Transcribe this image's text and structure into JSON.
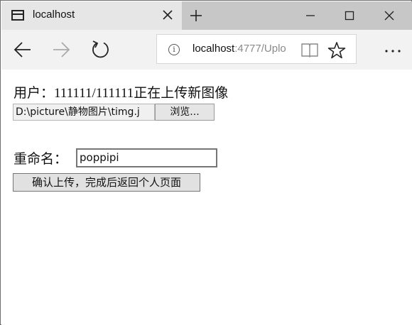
{
  "browser": {
    "tab_title": "localhost",
    "url_host": "localhost",
    "url_rest": ":4777/Uplo"
  },
  "page": {
    "heading_prefix": "用户：",
    "heading_user": "111111/111111",
    "heading_suffix": "正在上传新图像",
    "file_path": "D:\\picture\\静物图片\\timg.j",
    "browse_label": "浏览...",
    "rename_label": "重命名：",
    "rename_value": "poppipi",
    "submit_label": "确认上传，完成后返回个人页面"
  },
  "icons": [
    "tab-page-icon",
    "close-tab-icon",
    "new-tab-icon",
    "minimize-icon",
    "maximize-icon",
    "close-window-icon",
    "back-icon",
    "forward-icon",
    "refresh-icon",
    "info-icon",
    "reading-view-icon",
    "favorite-star-icon",
    "more-icon"
  ]
}
